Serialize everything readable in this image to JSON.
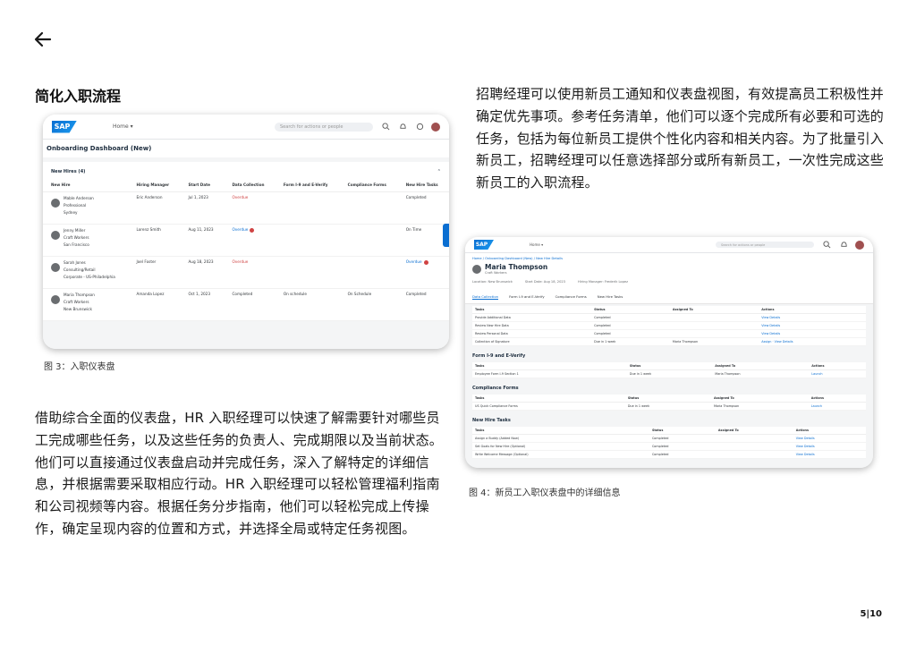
{
  "page": {
    "left_title": "简化入职流程",
    "right_paragraph": "招聘经理可以使用新员工通知和仪表盘视图，有效提高员工积极性并确定优先事项。参考任务清单，他们可以逐个完成所有必要和可选的任务，包括为每位新员工提供个性化内容和相关内容。为了批量引入新员工，招聘经理可以任意选择部分或所有新员工，一次性完成这些新员工的入职流程。",
    "left_paragraph": "借助综合全面的仪表盘，HR 入职经理可以快速了解需要针对哪些员工完成哪些任务，以及这些任务的负责人、完成期限以及当前状态。他们可以直接通过仪表盘启动并完成任务，深入了解特定的详细信息，并根据需要采取相应行动。HR 入职经理可以轻松管理福利指南和公司视频等内容。根据任务分步指南，他们可以轻松完成上传操作，确定呈现内容的位置和方式，并选择全局或特定任务视图。",
    "caption_fig3": "图 3：入职仪表盘",
    "caption_fig4": "图 4：新员工入职仪表盘中的详细信息",
    "page_number": "5|10"
  },
  "fig3": {
    "logo": "SAP",
    "home": "Home ▾",
    "search_placeholder": "Search for actions or people",
    "dashboard_title": "Onboarding Dashboard (New)",
    "section_title": "New Hires (4)",
    "columns": [
      "New Hire",
      "Hiring Manager",
      "Start Date",
      "Data Collection",
      "Form I-9 and E-Verify",
      "Compliance Forms",
      "New Hire Tasks"
    ],
    "rows": [
      {
        "name": "Mable Anderson",
        "role": "Professional",
        "loc": "Sydney",
        "manager": "Eric Anderson",
        "start": "Jul 1, 2023",
        "data": "Overdue",
        "i9": "",
        "compliance": "",
        "tasks": "Completed"
      },
      {
        "name": "Jenny Miller",
        "role": "Craft Workers",
        "loc": "San Francisco",
        "manager": "Lorenz Smith",
        "start": "Aug 11, 2023",
        "data": "Overdue",
        "i9": "",
        "compliance": "",
        "tasks": "On Time"
      },
      {
        "name": "Sarah Jones",
        "role": "Consulting/Retail",
        "loc": "Corporate - US-Philadelphia",
        "manager": "Joel Foster",
        "start": "Aug 18, 2023",
        "data": "Overdue",
        "i9": "",
        "compliance": "",
        "tasks": "Overdue"
      },
      {
        "name": "Maria Thompson",
        "role": "Craft Workers",
        "loc": "New Brunswick",
        "manager": "Amanda Lopez",
        "start": "Oct 1, 2023",
        "data": "Completed",
        "i9": "On schedule",
        "compliance": "On Schedule",
        "tasks": "Completed"
      }
    ]
  },
  "fig4": {
    "logo": "SAP",
    "home": "Home ▾",
    "search_placeholder": "Search for actions or people",
    "breadcrumb": "Home / Onboarding Dashboard (New) / New Hire Details",
    "person_name": "Maria Thompson",
    "person_role": "Craft Workers",
    "meta": [
      "Location: New Brunswick",
      "Start Date: Aug 18, 2023",
      "Hiring Manager: Frederik Lopez"
    ],
    "tabs": [
      "Data Collection",
      "Form I-9 and E-Verify",
      "Compliance Forms",
      "New Hire Tasks"
    ],
    "table_headers": [
      "Tasks",
      "Status",
      "Assigned To",
      "Actions"
    ],
    "sections": [
      {
        "title": "",
        "rows": [
          [
            "Provide Additional Data",
            "Completed",
            "",
            "View Details"
          ],
          [
            "Review New Hire Data",
            "Completed",
            "",
            "View Details"
          ],
          [
            "Review Personal Data",
            "Completed",
            "",
            "View Details"
          ],
          [
            "Collection of Signature",
            "Due in 1 week",
            "Maria Thompson",
            "Assign · View Details"
          ]
        ]
      },
      {
        "title": "Form I-9 and E-Verify",
        "rows": [
          [
            "Employee Form I-9 Section 1",
            "Due in 1 week",
            "Maria Thompson",
            "Launch"
          ]
        ]
      },
      {
        "title": "Compliance Forms",
        "rows": [
          [
            "US Quick Compliance Forms",
            "Due in 1 week",
            "Maria Thompson",
            "Launch"
          ]
        ]
      },
      {
        "title": "New Hire Tasks",
        "rows": [
          [
            "Assign a Buddy (Added Now)",
            "Completed",
            "",
            "View Details"
          ],
          [
            "Set Goals for New Hire (Optional)",
            "Completed",
            "",
            "View Details"
          ],
          [
            "Write Welcome Message (Optional)",
            "Completed",
            "",
            "View Details"
          ]
        ]
      }
    ]
  }
}
